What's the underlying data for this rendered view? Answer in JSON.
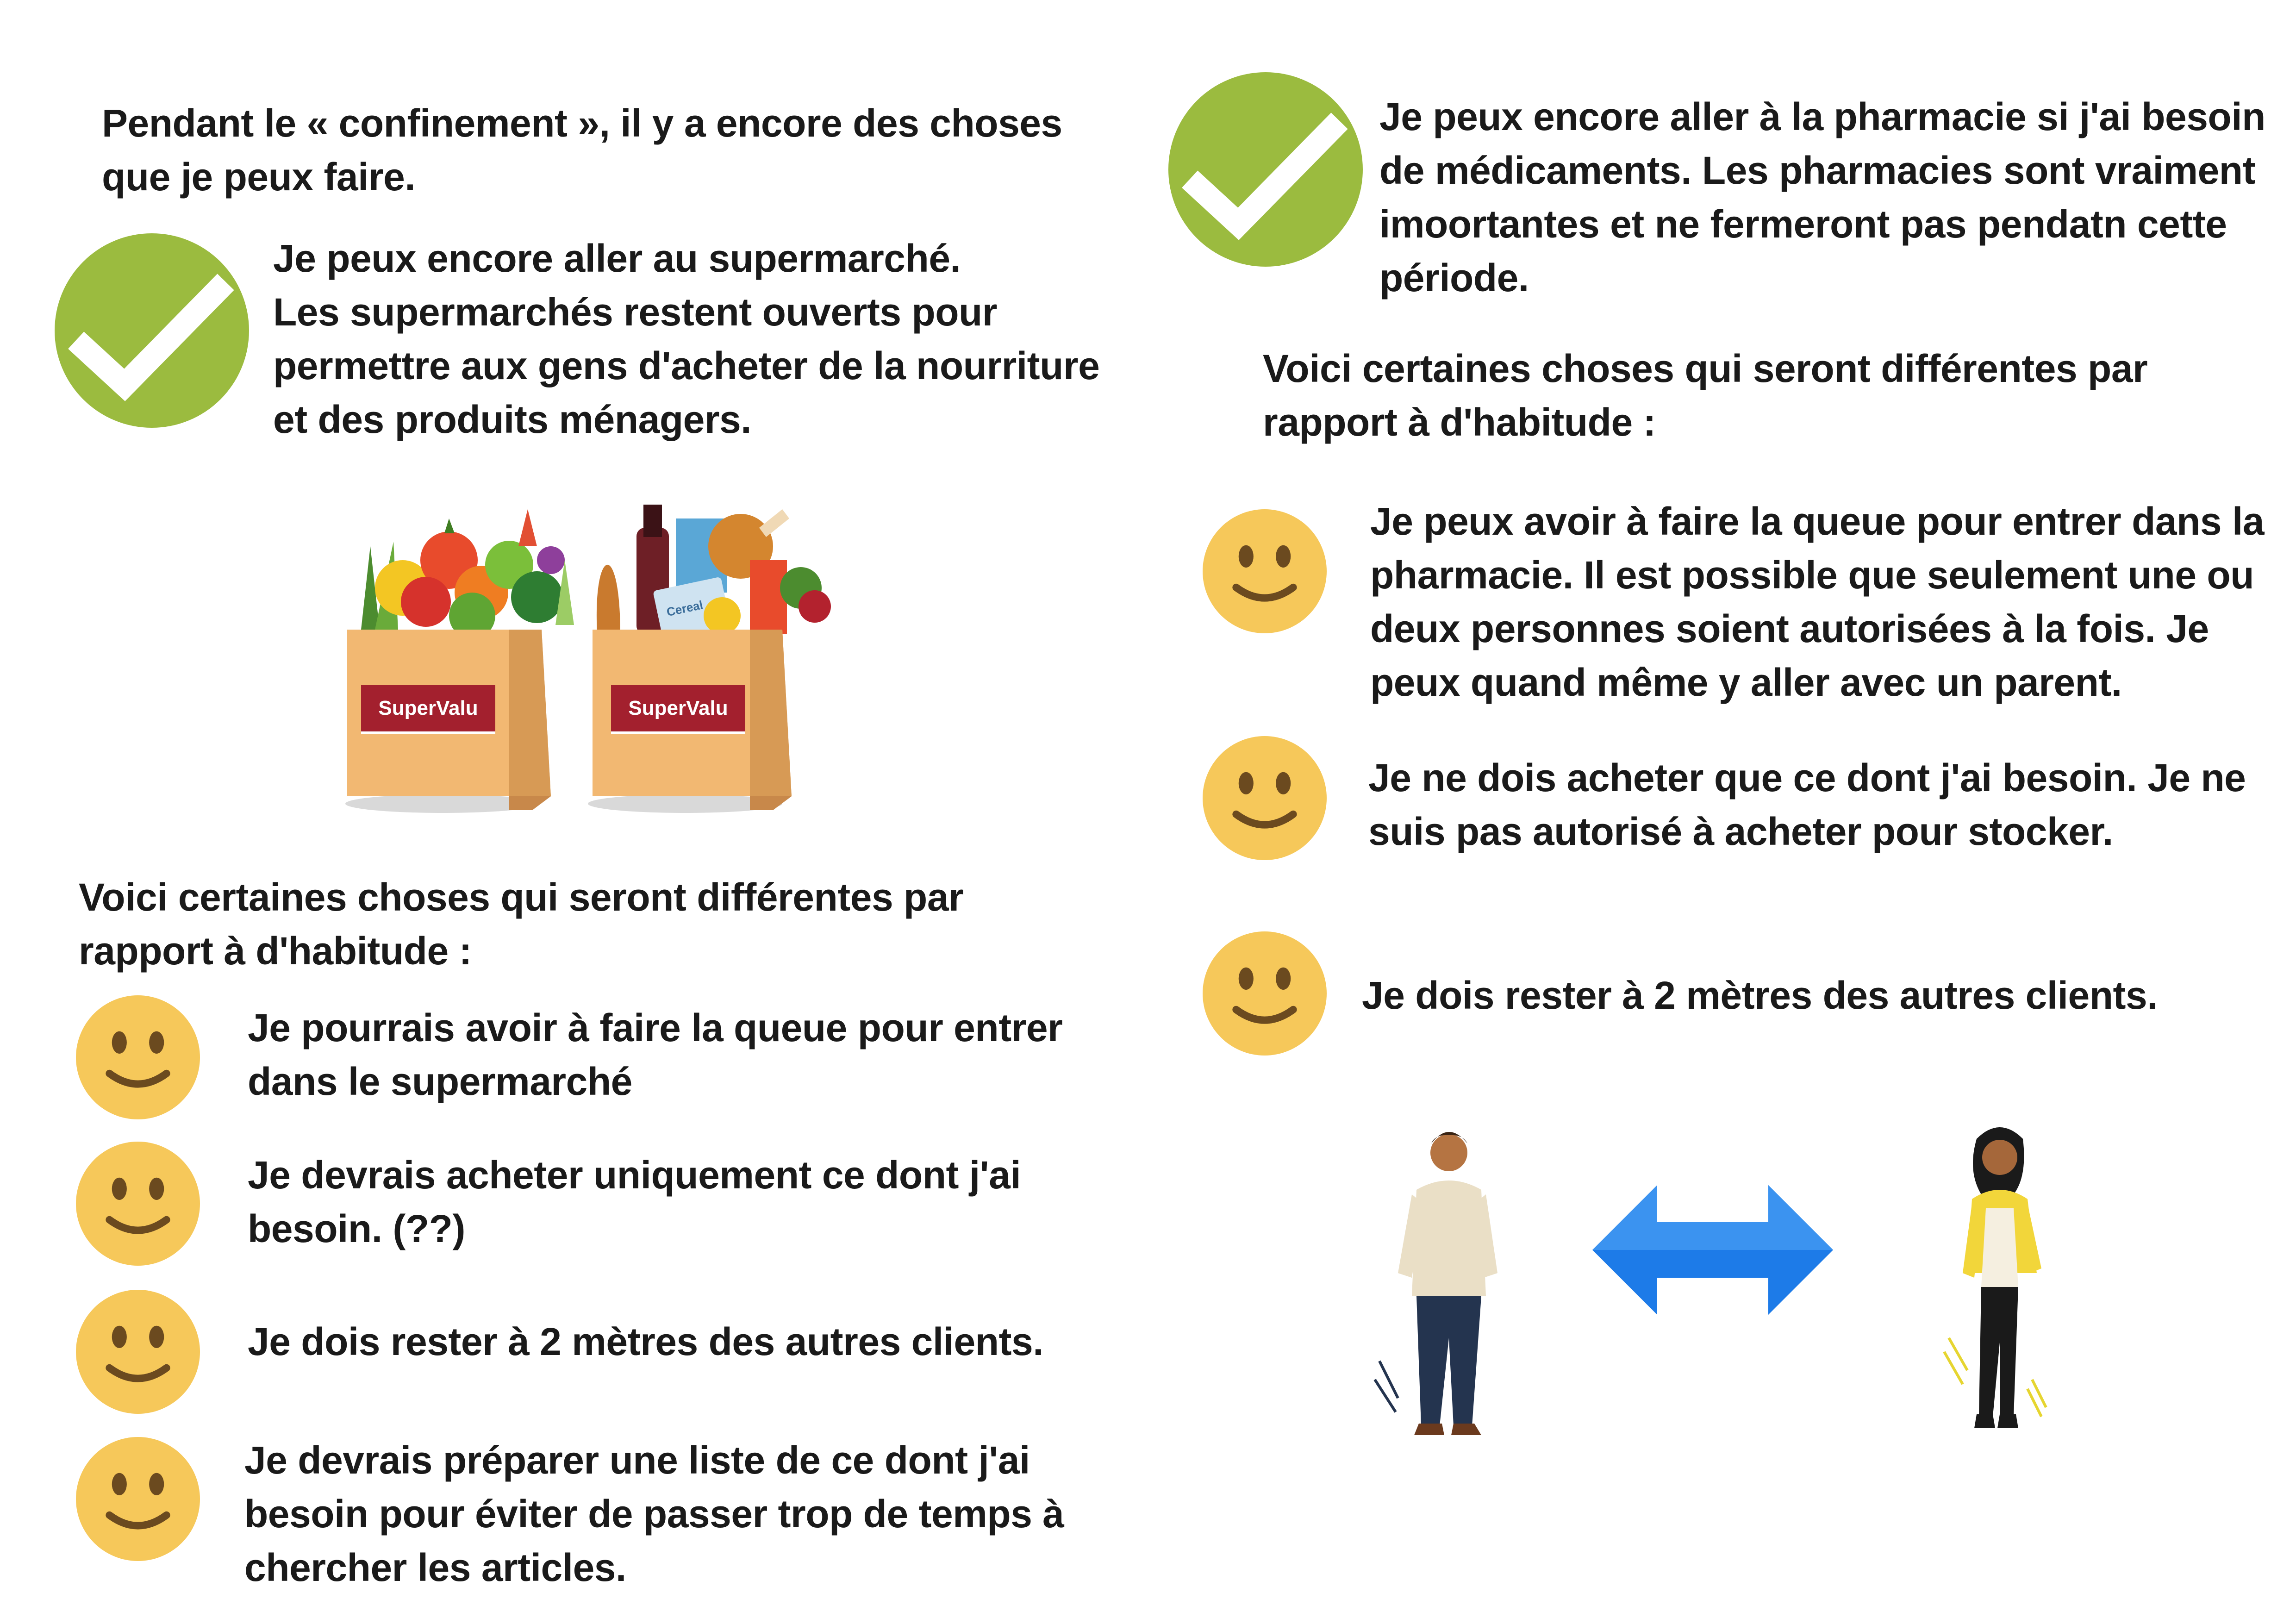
{
  "left": {
    "intro": [
      "Pendant le « confinement », il y a encore des choses",
      "que je peux faire."
    ],
    "supermarket": {
      "icon": "checkmark-icon",
      "lines": [
        "Je peux encore aller au supermarché.",
        "Les supermarchés restent ouverts pour",
        "permettre aux gens d'acheter de la nourriture",
        "et des produits ménagers."
      ]
    },
    "bag_label": "SuperValu",
    "bag_label_2": "SuperValu",
    "cereal_label": "Cereal",
    "differences_heading": [
      "Voici certaines choses qui seront différentes par",
      "rapport à d'habitude :"
    ],
    "items": [
      {
        "icon": "smiley-icon",
        "lines": [
          "Je pourrais avoir à faire la queue pour entrer",
          "dans le supermarché"
        ]
      },
      {
        "icon": "smiley-icon",
        "lines": [
          "Je devrais acheter uniquement ce dont j'ai",
          "besoin. (??)"
        ]
      },
      {
        "icon": "smiley-icon",
        "lines": [
          "Je dois rester à 2 mètres des autres clients."
        ]
      },
      {
        "icon": "smiley-icon",
        "lines": [
          "Je devrais préparer une liste de ce dont j'ai",
          "besoin pour éviter de passer trop de temps à",
          "chercher les articles."
        ]
      }
    ]
  },
  "right": {
    "pharmacy": {
      "icon": "checkmark-icon",
      "lines": [
        "Je peux encore aller à la pharmacie si j'ai besoin",
        "de médicaments. Les pharmacies sont vraiment",
        "imoortantes et ne fermeront pas pendatn cette",
        "période."
      ]
    },
    "differences_heading": [
      "Voici certaines choses qui seront différentes par",
      "rapport à d'habitude :"
    ],
    "items": [
      {
        "icon": "smiley-icon",
        "lines": [
          "Je peux avoir à faire la queue pour entrer dans la",
          "pharmacie. Il est possible que seulement une ou",
          "deux personnes soient autorisées à la fois. Je",
          "peux quand même y aller avec un parent."
        ]
      },
      {
        "icon": "smiley-icon",
        "lines": [
          "Je ne dois acheter que ce dont j'ai besoin. Je ne",
          "suis pas autorisé à acheter pour stocker."
        ]
      },
      {
        "icon": "smiley-icon",
        "lines": [
          "Je dois rester à 2 mètres des autres clients."
        ]
      }
    ],
    "distance_illustration": {
      "icon": "double-arrow-icon"
    }
  },
  "colors": {
    "check_green": "#9bbb3f",
    "smiley_yellow": "#f6c85a",
    "smiley_features": "#6b4a1f",
    "bag_tan": "#f2b872",
    "bag_brand_red": "#a3202e",
    "arrow_blue": "#1d7be8"
  }
}
